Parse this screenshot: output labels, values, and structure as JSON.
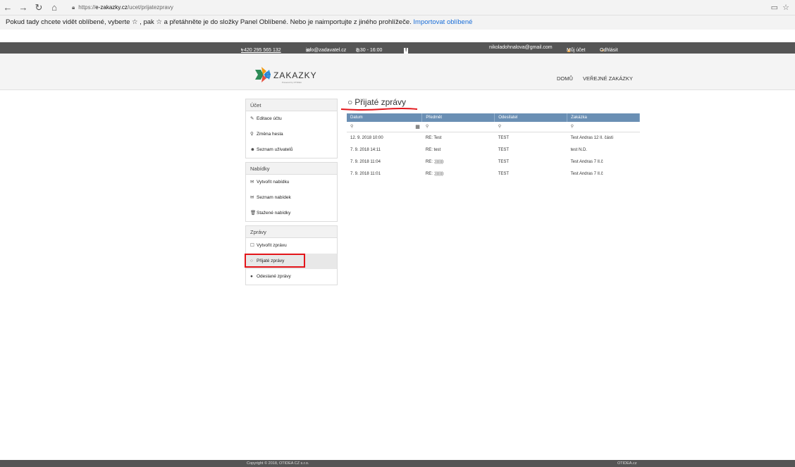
{
  "browser": {
    "url_prefix": "https://",
    "url_domain": "e-zakazky.cz",
    "url_path": "/ucet/prijatezpravy",
    "favorites_text": "Pokud tady chcete vidět oblíbené, vyberte ☆ , pak ☆ a přetáhněte je do složky Panel Oblíbené. Nebo je naimportujte z jiného prohlížeče.",
    "favorites_link": "Importovat oblíbené"
  },
  "topbar": {
    "phone": "+420 295 565 132",
    "email": "info@zadavatel.cz",
    "hours": "8:30 - 16:00",
    "facebook": "f",
    "user_email": "nikoladohnalova@gmail.com",
    "my_account": "Můj účet",
    "logout": "Odhlásit"
  },
  "header": {
    "logo_e": "e",
    "logo_text": "ZAKAZKY",
    "logo_sub": "Powered by OTIDEA",
    "menu": [
      "DOMŮ",
      "VEŘEJNÉ ZAKÁZKY"
    ]
  },
  "sidebar": {
    "groups": [
      {
        "title": "Účet",
        "items": [
          {
            "icon": "✎",
            "label": "Editace účtu"
          },
          {
            "icon": "⚲",
            "label": "Změna hesla"
          },
          {
            "icon": "☻",
            "label": "Seznam uživatelů"
          }
        ]
      },
      {
        "title": "Nabídky",
        "items": [
          {
            "icon": "✉",
            "label": "Vytvořit nabídku"
          },
          {
            "icon": "✉",
            "label": "Seznam nabídek"
          },
          {
            "icon": "🗑",
            "label": "Stažené nabídky"
          }
        ]
      },
      {
        "title": "Zprávy",
        "items": [
          {
            "icon": "☐",
            "label": "Vytvořit zprávu"
          },
          {
            "icon": "○",
            "label": "Přijaté zprávy"
          },
          {
            "icon": "●",
            "label": "Odeslané zprávy"
          }
        ]
      }
    ]
  },
  "main": {
    "title": "Přijaté zprávy",
    "columns": [
      "Datum",
      "Předmět",
      "Odesílatel",
      "Zakázka"
    ],
    "rows": [
      [
        "12. 9. 2018 10:00",
        "RE: Test",
        "TEST",
        "Test Andras 12 II. části"
      ],
      [
        "7. 9. 2018 14:11",
        "RE: test",
        "TEST",
        "test N.D."
      ],
      [
        "7. 9. 2018 11:04",
        "RE: ;))))))",
        "TEST",
        "Test Andras 7 II.č"
      ],
      [
        "7. 9. 2018 11:01",
        "RE: ;))))))",
        "TEST",
        "Test Andras 7 II.č"
      ]
    ]
  },
  "footer": {
    "copyright": "Copyright © 2018, OTIDEA CZ s.r.o.",
    "site": "OTIDEA.cz"
  }
}
